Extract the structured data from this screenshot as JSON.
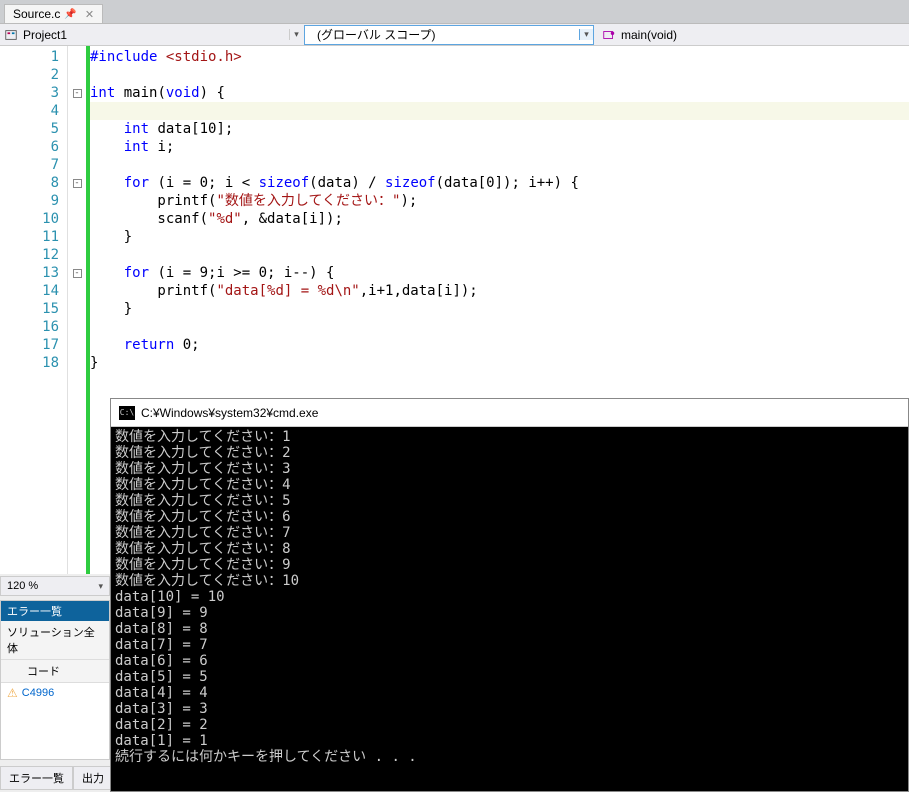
{
  "tab": {
    "filename": "Source.c"
  },
  "dropdowns": {
    "project": "Project1",
    "scope": "(グローバル スコープ)",
    "func": "main(void)"
  },
  "zoom": "120 %",
  "error_panel": {
    "title": "エラー一覧",
    "scope": "ソリューション全体",
    "col_code": "コード",
    "rows": [
      {
        "code": "C4996"
      }
    ]
  },
  "bottom_tabs": [
    "エラー一覧",
    "出力"
  ],
  "console": {
    "title": "C:¥Windows¥system32¥cmd.exe",
    "lines": [
      "数値を入力してください：1",
      "数値を入力してください：2",
      "数値を入力してください：3",
      "数値を入力してください：4",
      "数値を入力してください：5",
      "数値を入力してください：6",
      "数値を入力してください：7",
      "数値を入力してください：8",
      "数値を入力してください：9",
      "数値を入力してください：10",
      "data[10] = 10",
      "data[9] = 9",
      "data[8] = 8",
      "data[7] = 7",
      "data[6] = 6",
      "data[5] = 5",
      "data[4] = 4",
      "data[3] = 3",
      "data[2] = 2",
      "data[1] = 1",
      "続行するには何かキーを押してください . . ."
    ]
  },
  "code": {
    "line_count": 18,
    "lines": [
      {
        "n": 1,
        "fold": "",
        "tokens": [
          {
            "t": "#include ",
            "c": "kw"
          },
          {
            "t": "<stdio.h>",
            "c": "str"
          }
        ]
      },
      {
        "n": 2,
        "fold": "",
        "tokens": []
      },
      {
        "n": 3,
        "fold": "box",
        "tokens": [
          {
            "t": "int",
            "c": "kw"
          },
          {
            "t": " main(",
            "c": ""
          },
          {
            "t": "void",
            "c": "kw"
          },
          {
            "t": ") {",
            "c": ""
          }
        ]
      },
      {
        "n": 4,
        "fold": "",
        "hl": true,
        "tokens": []
      },
      {
        "n": 5,
        "fold": "",
        "tokens": [
          {
            "t": "    ",
            "c": ""
          },
          {
            "t": "int",
            "c": "kw"
          },
          {
            "t": " data[10];",
            "c": ""
          }
        ]
      },
      {
        "n": 6,
        "fold": "",
        "tokens": [
          {
            "t": "    ",
            "c": ""
          },
          {
            "t": "int",
            "c": "kw"
          },
          {
            "t": " i;",
            "c": ""
          }
        ]
      },
      {
        "n": 7,
        "fold": "",
        "tokens": []
      },
      {
        "n": 8,
        "fold": "box",
        "tokens": [
          {
            "t": "    ",
            "c": ""
          },
          {
            "t": "for",
            "c": "kw"
          },
          {
            "t": " (i = 0; i < ",
            "c": ""
          },
          {
            "t": "sizeof",
            "c": "kw"
          },
          {
            "t": "(data) / ",
            "c": ""
          },
          {
            "t": "sizeof",
            "c": "kw"
          },
          {
            "t": "(data[0]); i++) {",
            "c": ""
          }
        ]
      },
      {
        "n": 9,
        "fold": "",
        "tokens": [
          {
            "t": "        printf(",
            "c": ""
          },
          {
            "t": "\"数値を入力してください：\"",
            "c": "str"
          },
          {
            "t": ");",
            "c": ""
          }
        ]
      },
      {
        "n": 10,
        "fold": "",
        "tokens": [
          {
            "t": "        scanf(",
            "c": ""
          },
          {
            "t": "\"%d\"",
            "c": "str"
          },
          {
            "t": ", &data[i]);",
            "c": ""
          }
        ]
      },
      {
        "n": 11,
        "fold": "",
        "tokens": [
          {
            "t": "    }",
            "c": ""
          }
        ]
      },
      {
        "n": 12,
        "fold": "",
        "tokens": []
      },
      {
        "n": 13,
        "fold": "box",
        "tokens": [
          {
            "t": "    ",
            "c": ""
          },
          {
            "t": "for",
            "c": "kw"
          },
          {
            "t": " (i = 9;i >= 0; i--) {",
            "c": ""
          }
        ]
      },
      {
        "n": 14,
        "fold": "",
        "tokens": [
          {
            "t": "        printf(",
            "c": ""
          },
          {
            "t": "\"data[%d] = %d\\n\"",
            "c": "str"
          },
          {
            "t": ",i+1,data[i]);",
            "c": ""
          }
        ]
      },
      {
        "n": 15,
        "fold": "",
        "tokens": [
          {
            "t": "    }",
            "c": ""
          }
        ]
      },
      {
        "n": 16,
        "fold": "",
        "tokens": []
      },
      {
        "n": 17,
        "fold": "",
        "tokens": [
          {
            "t": "    ",
            "c": ""
          },
          {
            "t": "return",
            "c": "kw"
          },
          {
            "t": " 0;",
            "c": ""
          }
        ]
      },
      {
        "n": 18,
        "fold": "",
        "tokens": [
          {
            "t": "}",
            "c": ""
          }
        ]
      }
    ]
  }
}
